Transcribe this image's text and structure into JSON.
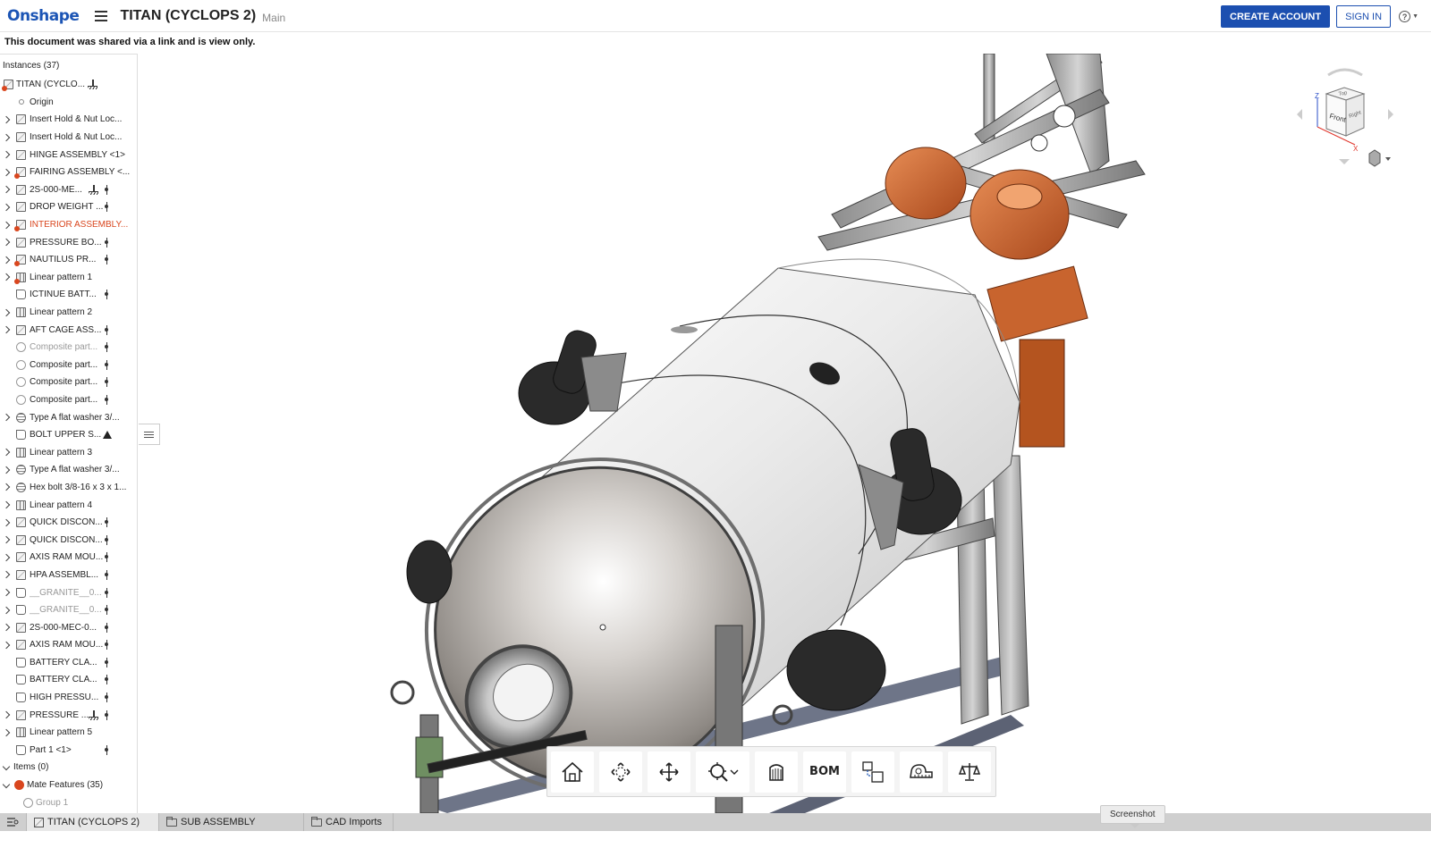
{
  "topbar": {
    "logo": "Onshape",
    "doc_title": "TITAN (CYCLOPS 2)",
    "workspace": "Main",
    "create_account": "CREATE ACCOUNT",
    "sign_in": "SIGN IN",
    "help": "?"
  },
  "notice": "This document was shared via a link and is view only.",
  "panel": {
    "header": "Instances (37)",
    "rows": [
      {
        "label": "TITAN (CYCLO...",
        "level": 0,
        "icon": "assembly-warn",
        "suffix": "fixed"
      },
      {
        "label": "Origin",
        "level": 1,
        "icon": "origin"
      },
      {
        "label": "Insert Hold & Nut Loc...",
        "level": 1,
        "icon": "assembly",
        "arrow": true
      },
      {
        "label": "Insert Hold & Nut Loc...",
        "level": 1,
        "icon": "assembly",
        "arrow": true
      },
      {
        "label": "HINGE ASSEMBLY <1>",
        "level": 1,
        "icon": "assembly",
        "arrow": true
      },
      {
        "label": "FAIRING ASSEMBLY <...",
        "level": 1,
        "icon": "assembly-warn",
        "arrow": true
      },
      {
        "label": "2S-000-ME...",
        "level": 1,
        "icon": "assembly",
        "arrow": true,
        "suffix": "fixed-dot"
      },
      {
        "label": "DROP WEIGHT ...",
        "level": 1,
        "icon": "assembly",
        "arrow": true,
        "suffix": "dot"
      },
      {
        "label": "INTERIOR ASSEMBLY...",
        "level": 1,
        "icon": "assembly-warn",
        "arrow": true,
        "state": "error"
      },
      {
        "label": "PRESSURE BO...",
        "level": 1,
        "icon": "assembly",
        "arrow": true,
        "suffix": "dot"
      },
      {
        "label": "NAUTILUS PR...",
        "level": 1,
        "icon": "assembly-warn",
        "arrow": true,
        "suffix": "dot"
      },
      {
        "label": "Linear pattern 1",
        "level": 1,
        "icon": "pattern-warn",
        "arrow": true
      },
      {
        "label": "ICTINUE BATT...",
        "level": 1,
        "icon": "part",
        "suffix": "dot"
      },
      {
        "label": "Linear pattern 2",
        "level": 1,
        "icon": "pattern",
        "arrow": true
      },
      {
        "label": "AFT CAGE ASS...",
        "level": 1,
        "icon": "assembly",
        "arrow": true,
        "suffix": "dot"
      },
      {
        "label": "Composite part...",
        "level": 1,
        "icon": "composite",
        "state": "faded",
        "suffix": "dot"
      },
      {
        "label": "Composite part...",
        "level": 1,
        "icon": "composite",
        "suffix": "dot"
      },
      {
        "label": "Composite part...",
        "level": 1,
        "icon": "composite",
        "suffix": "dot"
      },
      {
        "label": "Composite part...",
        "level": 1,
        "icon": "composite",
        "suffix": "dot"
      },
      {
        "label": "Type A flat washer 3/...",
        "level": 1,
        "icon": "washer",
        "arrow": true
      },
      {
        "label": "BOLT UPPER S...",
        "level": 1,
        "icon": "part",
        "suffix": "triangle"
      },
      {
        "label": "Linear pattern 3",
        "level": 1,
        "icon": "pattern",
        "arrow": true
      },
      {
        "label": "Type A flat washer 3/...",
        "level": 1,
        "icon": "washer",
        "arrow": true
      },
      {
        "label": "Hex bolt 3/8-16 x 3 x 1...",
        "level": 1,
        "icon": "washer",
        "arrow": true
      },
      {
        "label": "Linear pattern 4",
        "level": 1,
        "icon": "pattern",
        "arrow": true
      },
      {
        "label": "QUICK DISCON...",
        "level": 1,
        "icon": "assembly",
        "arrow": true,
        "suffix": "dot"
      },
      {
        "label": "QUICK DISCON...",
        "level": 1,
        "icon": "assembly",
        "arrow": true,
        "suffix": "dot"
      },
      {
        "label": "AXIS RAM MOU...",
        "level": 1,
        "icon": "assembly",
        "arrow": true,
        "suffix": "dot"
      },
      {
        "label": "HPA ASSEMBL...",
        "level": 1,
        "icon": "assembly",
        "arrow": true,
        "suffix": "dot"
      },
      {
        "label": "__GRANITE__0...",
        "level": 1,
        "icon": "part",
        "arrow": true,
        "state": "faded",
        "suffix": "dot"
      },
      {
        "label": "__GRANITE__0...",
        "level": 1,
        "icon": "part",
        "arrow": true,
        "state": "faded",
        "suffix": "dot"
      },
      {
        "label": "2S-000-MEC-0...",
        "level": 1,
        "icon": "assembly",
        "arrow": true,
        "suffix": "dot"
      },
      {
        "label": "AXIS RAM MOU...",
        "level": 1,
        "icon": "assembly",
        "arrow": true,
        "suffix": "dot"
      },
      {
        "label": "BATTERY CLA...",
        "level": 1,
        "icon": "part",
        "suffix": "dot"
      },
      {
        "label": "BATTERY CLA...",
        "level": 1,
        "icon": "part",
        "suffix": "dot"
      },
      {
        "label": "HIGH PRESSU...",
        "level": 1,
        "icon": "part",
        "suffix": "dot"
      },
      {
        "label": "PRESSURE ...",
        "level": 1,
        "icon": "assembly",
        "arrow": true,
        "suffix": "fixed-dot"
      },
      {
        "label": "Linear pattern 5",
        "level": 1,
        "icon": "pattern",
        "arrow": true
      },
      {
        "label": "Part 1 <1>",
        "level": 1,
        "icon": "part",
        "suffix": "dot"
      },
      {
        "label": "Items (0)",
        "level": 0,
        "icon": "none",
        "arrow": "down"
      },
      {
        "label": "Mate Features (35)",
        "level": 0,
        "icon": "mate",
        "arrow": "down"
      },
      {
        "label": "Group 1",
        "level": 1,
        "icon": "composite",
        "state": "faded",
        "indent": 26
      }
    ]
  },
  "viewcube": {
    "top": "Top",
    "front": "Front",
    "right": "Right",
    "axis_x": "X",
    "axis_z": "Z"
  },
  "toolbar": {
    "tools": [
      "home-view-icon",
      "view-cube-icon",
      "pan-icon",
      "zoom-icon",
      "section-view-icon",
      "bom-icon",
      "explode-icon",
      "measure-icon",
      "mass-properties-icon"
    ],
    "bom_label": "BOM"
  },
  "tabs": [
    {
      "label": "TITAN (CYCLOPS 2)",
      "type": "assembly",
      "active": true
    },
    {
      "label": "SUB ASSEMBLY",
      "type": "folder"
    },
    {
      "label": "CAD Imports",
      "type": "folder"
    }
  ],
  "tooltip": "Screenshot",
  "colors": {
    "brand": "#1c55b5",
    "error": "#d9461e",
    "hull_orange": "#c8642e"
  }
}
